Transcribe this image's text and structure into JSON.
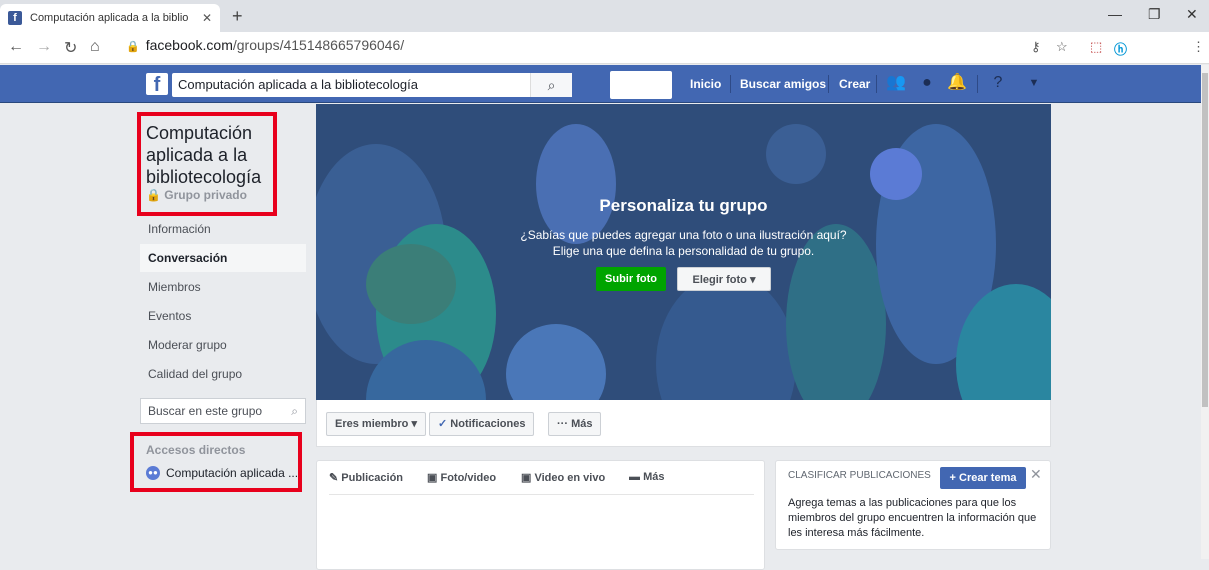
{
  "browser": {
    "tab_title": "Computación aplicada a la biblio",
    "favicon": "f",
    "url_domain": "facebook.com",
    "url_path": "/groups/415148665796046/"
  },
  "fb_header": {
    "search_value": "Computación aplicada a la bibliotecología",
    "nav": [
      "Inicio",
      "Buscar amigos",
      "Crear"
    ]
  },
  "group": {
    "name": "Computación aplicada a la bibliotecología",
    "privacy": "Grupo privado"
  },
  "left_nav": {
    "items": [
      {
        "label": "Información",
        "active": false
      },
      {
        "label": "Conversación",
        "active": true
      },
      {
        "label": "Miembros",
        "active": false
      },
      {
        "label": "Eventos",
        "active": false
      },
      {
        "label": "Moderar grupo",
        "active": false
      },
      {
        "label": "Calidad del grupo",
        "active": false
      }
    ],
    "search_placeholder": "Buscar en este grupo",
    "shortcuts_title": "Accesos directos",
    "shortcut_item": "Computación aplicada ..."
  },
  "cover": {
    "title": "Personaliza tu grupo",
    "line1": "¿Sabías que puedes agregar una foto o una ilustración aquí?",
    "line2": "Elige una que defina la personalidad de tu grupo.",
    "upload_btn": "Subir foto",
    "choose_btn": "Elegir foto"
  },
  "actions": {
    "member": "Eres miembro",
    "notifications": "Notificaciones",
    "more": "Más"
  },
  "composer": {
    "tabs": [
      "Publicación",
      "Foto/video",
      "Video en vivo",
      "Más"
    ]
  },
  "topics": {
    "title": "CLASIFICAR PUBLICACIONES",
    "create_btn": "+ Crear tema",
    "description": "Agrega temas a las publicaciones para que los miembros del grupo encuentren la información que les interesa más fácilmente."
  },
  "colors": {
    "fb_blue": "#4267b2",
    "highlight_red": "#e8001c",
    "green_button": "#00a400"
  }
}
